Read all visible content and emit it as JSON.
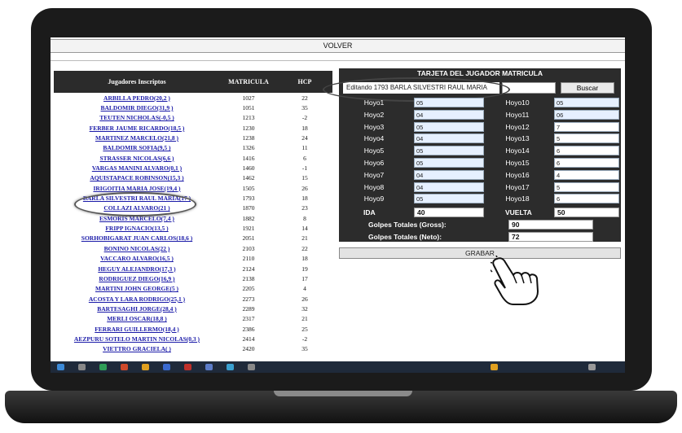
{
  "top_bar": {
    "volver_label": "VOLVER"
  },
  "players": {
    "headers": {
      "name": "Jugadores Inscriptos",
      "matricula": "MATRICULA",
      "hcp": "HCP"
    },
    "rows": [
      {
        "name": "ARBILLA PEDRO(20,2 )",
        "matricula": "1027",
        "hcp": "22"
      },
      {
        "name": "BALDOMIR DIEGO(31,9 )",
        "matricula": "1051",
        "hcp": "35"
      },
      {
        "name": "TEUTEN NICHOLAS(-0,5 )",
        "matricula": "1213",
        "hcp": "-2"
      },
      {
        "name": "FERBER JAUME RICARDO(18,5 )",
        "matricula": "1230",
        "hcp": "18"
      },
      {
        "name": "MARTINEZ MARCELO(21,8 )",
        "matricula": "1238",
        "hcp": "24"
      },
      {
        "name": "BALDOMIR SOFIA(9,5 )",
        "matricula": "1326",
        "hcp": "11"
      },
      {
        "name": "STRASSER NICOLAS(6,6 )",
        "matricula": "1416",
        "hcp": "6"
      },
      {
        "name": "VARGAS MANINI ALVARO(0,1 )",
        "matricula": "1460",
        "hcp": "-1"
      },
      {
        "name": "AQUISTAPACE ROBINSON(15,3 )",
        "matricula": "1462",
        "hcp": "15"
      },
      {
        "name": "IRIGOITIA MARIA JOSE(19,4 )",
        "matricula": "1505",
        "hcp": "26"
      },
      {
        "name": "BARLA SILVESTRI RAUL MARIA(17 )",
        "matricula": "1793",
        "hcp": "18"
      },
      {
        "name": "COLLAZI ALVARO(21 )",
        "matricula": "1870",
        "hcp": "23"
      },
      {
        "name": "ESMORIS MARCELO(7,4 )",
        "matricula": "1882",
        "hcp": "8"
      },
      {
        "name": "FRIPP IGNACIO(13,5 )",
        "matricula": "1921",
        "hcp": "14"
      },
      {
        "name": "SORHOBIGARAT JUAN CARLOS(18,6 )",
        "matricula": "2051",
        "hcp": "21"
      },
      {
        "name": "BONINO NICOLAS(22 )",
        "matricula": "2103",
        "hcp": "22"
      },
      {
        "name": "VACCARO ALVARO(16,5 )",
        "matricula": "2110",
        "hcp": "18"
      },
      {
        "name": "HEGUY ALEJANDRO(17,3 )",
        "matricula": "2124",
        "hcp": "19"
      },
      {
        "name": "RODRIGUEZ DIEGO(16,9 )",
        "matricula": "2138",
        "hcp": "17"
      },
      {
        "name": "MARTINI JOHN GEORGE(5 )",
        "matricula": "2205",
        "hcp": "4"
      },
      {
        "name": "ACOSTA Y LARA RODRIGO(25,1 )",
        "matricula": "2273",
        "hcp": "26"
      },
      {
        "name": "BARTESAGHI JORGE(28,4 )",
        "matricula": "2289",
        "hcp": "32"
      },
      {
        "name": "MERLI OSCAR(18,8 )",
        "matricula": "2317",
        "hcp": "21"
      },
      {
        "name": "FERRARI GUILLERMO(18,4 )",
        "matricula": "2386",
        "hcp": "25"
      },
      {
        "name": "AEZPURU SOTELO MARTIN NICOLAS(0,3 )",
        "matricula": "2414",
        "hcp": "-2"
      },
      {
        "name": "VIETTRO GRACIELA( )",
        "matricula": "2420",
        "hcp": "35"
      }
    ]
  },
  "scorecard": {
    "title": "TARJETA DEL JUGADOR MATRICULA",
    "editing_text": "Editando 1793 BARLA SILVESTRI RAUL MARIA",
    "search_value": "",
    "buscar_label": "Buscar",
    "front": [
      {
        "label": "Hoyo1",
        "value": "05"
      },
      {
        "label": "Hoyo2",
        "value": "04"
      },
      {
        "label": "Hoyo3",
        "value": "05"
      },
      {
        "label": "Hoyo4",
        "value": "04"
      },
      {
        "label": "Hoyo5",
        "value": "05"
      },
      {
        "label": "Hoyo6",
        "value": "05"
      },
      {
        "label": "Hoyo7",
        "value": "04"
      },
      {
        "label": "Hoyo8",
        "value": "04"
      },
      {
        "label": "Hoyo9",
        "value": "05"
      }
    ],
    "back": [
      {
        "label": "Hoyo10",
        "value": "05"
      },
      {
        "label": "Hoyo11",
        "value": "06"
      },
      {
        "label": "Hoyo12",
        "value": "7"
      },
      {
        "label": "Hoyo13",
        "value": "5"
      },
      {
        "label": "Hoyo14",
        "value": "6"
      },
      {
        "label": "Hoyo15",
        "value": "6"
      },
      {
        "label": "Hoyo16",
        "value": "4"
      },
      {
        "label": "Hoyo17",
        "value": "5"
      },
      {
        "label": "Hoyo18",
        "value": "6"
      }
    ],
    "ida_label": "IDA",
    "ida_value": "40",
    "vuelta_label": "VUELTA",
    "vuelta_value": "50",
    "gross_label": "Golpes Totales (Gross):",
    "gross_value": "90",
    "neto_label": "Golpes Totales (Neto):",
    "neto_value": "72",
    "grabar_label": "GRABAR"
  },
  "icons": [
    "hand-pointer-icon"
  ],
  "colors": {
    "header_bg": "#2b2b2b",
    "link": "#1a1aa8",
    "card_bg": "#2c2c2c"
  }
}
